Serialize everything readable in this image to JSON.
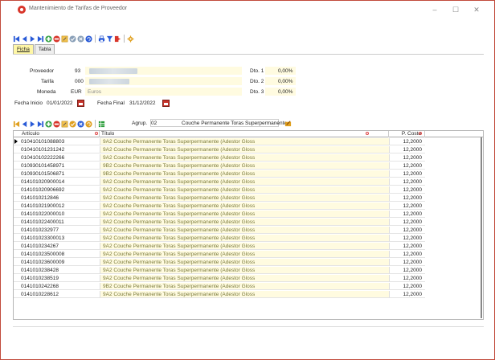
{
  "window": {
    "title": "Mantenimiento de Tarifas de Proveedor",
    "controls": {
      "minimize": "–",
      "maximize": "☐",
      "close": "✕"
    }
  },
  "toolbar_main": {
    "icons": [
      "first-icon",
      "prev-icon",
      "next-icon",
      "last-icon",
      "add-icon",
      "delete-icon",
      "edit-icon",
      "confirm-icon",
      "cancel-icon",
      "refresh-icon",
      "print-icon",
      "filter-icon",
      "exit-icon",
      "settings-icon"
    ]
  },
  "tabs": [
    {
      "label": "Ficha",
      "active": true
    },
    {
      "label": "Tabla",
      "active": false
    }
  ],
  "form": {
    "proveedor_label": "Proveedor",
    "proveedor_code": "93",
    "tarifa_label": "Tarifa",
    "tarifa_code": "000",
    "moneda_label": "Moneda",
    "moneda_code": "EUR",
    "moneda_name": "Euros",
    "fecha_inicio_label": "Fecha Inicio",
    "fecha_inicio": "01/01/2022",
    "fecha_final_label": "Fecha Final",
    "fecha_final": "31/12/2022",
    "dto1_label": "Dto. 1",
    "dto1_value": "0,00%",
    "dto2_label": "Dto. 2",
    "dto2_value": "0,00%",
    "dto3_label": "Dto. 3",
    "dto3_value": "0,00%"
  },
  "toolbar_grid": {
    "agrup_label": "Agrup.",
    "agrup_value": "02",
    "agrup_desc": "Couche Permanente Toras Superpermanente"
  },
  "grid": {
    "columns": {
      "articulo": "Artículo",
      "titulo": "Título",
      "coste": "P. Coste"
    },
    "rows": [
      {
        "articulo": "010410101088803",
        "titulo": "9A2 Couche Permanente Toras Superpermanente (Adestor Gloss",
        "coste": "12,2000"
      },
      {
        "articulo": "010410101231242",
        "titulo": "9A2 Couche Permanente Toras Superpermanente (Adestor Gloss",
        "coste": "12,2000"
      },
      {
        "articulo": "010410102222266",
        "titulo": "9A2 Couche Permanente Toras Superpermanente (Adestor Gloss",
        "coste": "12,2000"
      },
      {
        "articulo": "010930101458971",
        "titulo": "9B2 Couche Permanente Toras Superpermanente (Adestor Gloss",
        "coste": "12,2000"
      },
      {
        "articulo": "010930101506871",
        "titulo": "9B2 Couche Permanente Toras Superpermanente (Adestor Gloss",
        "coste": "12,2000"
      },
      {
        "articulo": "014101020900014",
        "titulo": "9A2 Couche Permanente Toras Superpermanente (Adestor Gloss",
        "coste": "12,2000"
      },
      {
        "articulo": "014101020906692",
        "titulo": "9A2 Couche Permanente Toras Superpermanente (Adestor Gloss",
        "coste": "12,2000"
      },
      {
        "articulo": "0141010212846",
        "titulo": "9A2 Couche Permanente Toras Superpermanente (Adestor Gloss",
        "coste": "12,2000"
      },
      {
        "articulo": "014101021900012",
        "titulo": "9A2 Couche Permanente Toras Superpermanente (Adestor Gloss",
        "coste": "12,2000"
      },
      {
        "articulo": "014101022000010",
        "titulo": "9A2 Couche Permanente Toras Superpermanente (Adestor Gloss",
        "coste": "12,2000"
      },
      {
        "articulo": "014101022400011",
        "titulo": "9A2 Couche Permanente Toras Superpermanente (Adestor Gloss",
        "coste": "12,2000"
      },
      {
        "articulo": "0141010232977",
        "titulo": "9A2 Couche Permanente Toras Superpermanente (Adestor Gloss",
        "coste": "12,2000"
      },
      {
        "articulo": "014101023300013",
        "titulo": "9A2 Couche Permanente Toras Superpermanente (Adestor Gloss",
        "coste": "12,2000"
      },
      {
        "articulo": "0141010234267",
        "titulo": "9A2 Couche Permanente Toras Superpermanente (Adestor Gloss",
        "coste": "12,2000"
      },
      {
        "articulo": "014101023500008",
        "titulo": "9A2 Couche Permanente Toras Superpermanente (Adestor Gloss",
        "coste": "12,2000"
      },
      {
        "articulo": "014101023600009",
        "titulo": "9A2 Couche Permanente Toras Superpermanente (Adestor Gloss",
        "coste": "12,2000"
      },
      {
        "articulo": "0141010238428",
        "titulo": "9A2 Couche Permanente Toras Superpermanente (Adestor Gloss",
        "coste": "12,2000"
      },
      {
        "articulo": "0141010238519",
        "titulo": "9A2 Couche Permanente Toras Superpermanente (Adestor Gloss",
        "coste": "12,2000"
      },
      {
        "articulo": "0141010242268",
        "titulo": "9B2 Couche Permanente Toras Superpermanente (Adestor Gloss",
        "coste": "12,2000"
      },
      {
        "articulo": "0141010228612",
        "titulo": "9A2 Couche Permanente Toras Superpermanente (Adestor Gloss",
        "coste": "12,2000"
      }
    ]
  },
  "colors": {
    "accent_border": "#c14b3c",
    "field_bg": "#fffbe0",
    "nav_blue": "#2a5bd7",
    "add_green": "#2a9d3a",
    "delete_red": "#d8352a"
  }
}
